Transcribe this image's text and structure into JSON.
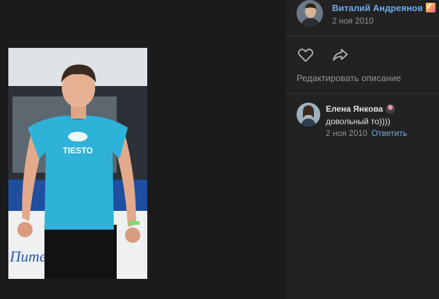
{
  "author": {
    "name": "Виталий Андреянов",
    "date": "2 ноя 2010"
  },
  "actions": {
    "like_icon": "heart-icon",
    "share_icon": "share-arrow-icon",
    "edit_description": "Редактировать описание"
  },
  "comments": [
    {
      "name": "Елена Янкова",
      "text": "довольный то))))",
      "date": "2 ноя 2010",
      "reply_label": "Ответить"
    }
  ],
  "photo": {
    "shirt_logo_text": "TIESTO"
  },
  "colors": {
    "link": "#71aaeb",
    "background": "#222222",
    "muted": "#939393",
    "text": "#e1e3e6"
  }
}
